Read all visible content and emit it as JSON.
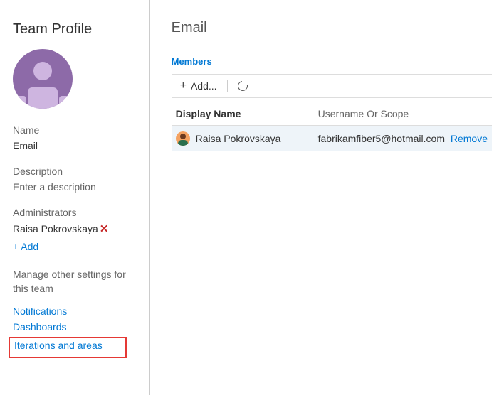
{
  "sidebar": {
    "title": "Team Profile",
    "name_label": "Name",
    "name_value": "Email",
    "desc_label": "Description",
    "desc_placeholder": "Enter a description",
    "admins_label": "Administrators",
    "admins": [
      {
        "name": "Raisa Pokrovskaya"
      }
    ],
    "add_label": "+ Add",
    "settings_header": "Manage other settings for this team",
    "links": {
      "notifications": "Notifications",
      "dashboards": "Dashboards",
      "iterations": "Iterations and areas"
    }
  },
  "main": {
    "title": "Email",
    "members_label": "Members",
    "toolbar": {
      "add_label": "Add..."
    },
    "columns": {
      "name": "Display Name",
      "user": "Username Or Scope"
    },
    "rows": [
      {
        "name": "Raisa Pokrovskaya",
        "user": "fabrikamfiber5@hotmail.com",
        "action": "Remove"
      }
    ]
  }
}
